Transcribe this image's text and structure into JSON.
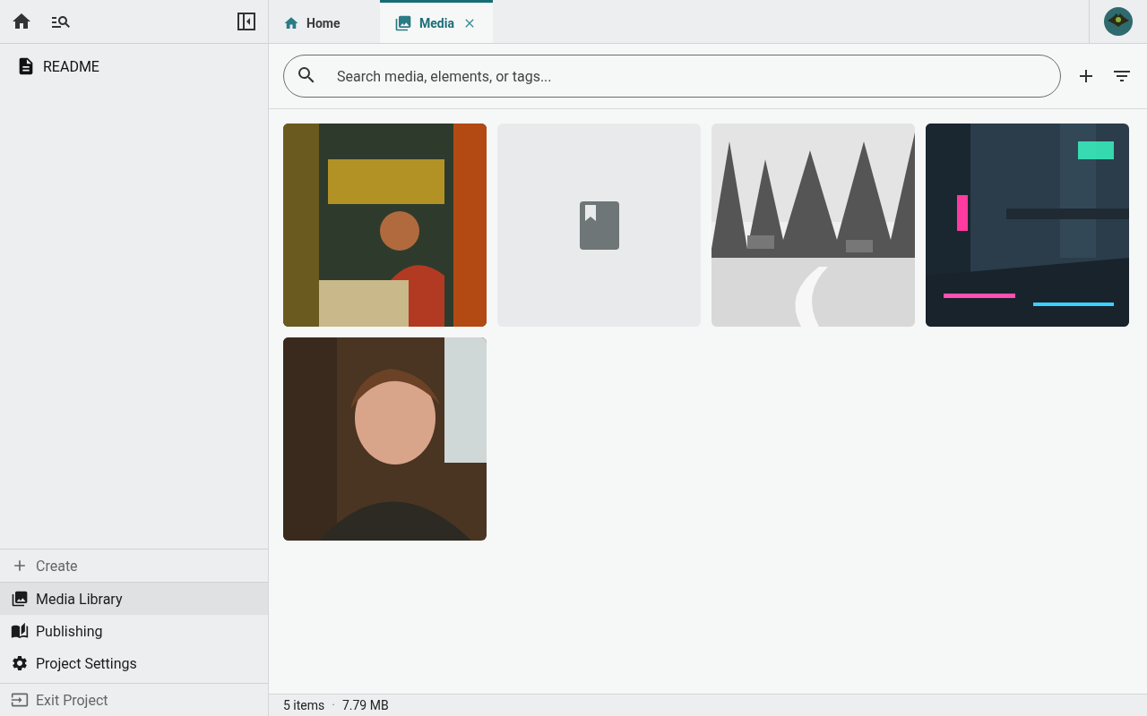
{
  "sidebar": {
    "tree": [
      {
        "label": "README",
        "kind": "document"
      }
    ],
    "create": {
      "label": "Create"
    },
    "nav": [
      {
        "label": "Media Library",
        "selected": true
      },
      {
        "label": "Publishing",
        "selected": false
      },
      {
        "label": "Project Settings",
        "selected": false
      }
    ],
    "exit": {
      "label": "Exit Project"
    }
  },
  "tabs": [
    {
      "label": "Home",
      "selected": false
    },
    {
      "label": "Media",
      "selected": true
    }
  ],
  "search": {
    "placeholder": "Search media, elements, or tags..."
  },
  "media": [
    {
      "kind": "picture"
    },
    {
      "kind": "placeholder"
    },
    {
      "kind": "picture"
    },
    {
      "kind": "picture"
    },
    {
      "kind": "picture"
    }
  ],
  "status_bar": {
    "count": "5 items",
    "separator": "·",
    "size": "7.79 MB"
  }
}
